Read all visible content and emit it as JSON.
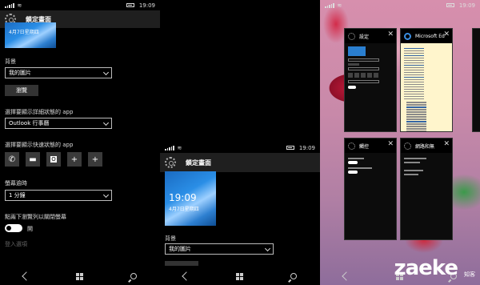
{
  "panel1": {
    "status_time": "19:09",
    "header_title": "鎖定畫面",
    "preview_date": "4月7日星期四",
    "background_label": "背景",
    "background_value": "我的圖片",
    "browse_button": "瀏覽",
    "detail_app_label": "選擇要顯示詳細狀態的 app",
    "detail_app_value": "Outlook 行事曆",
    "quick_app_label": "選擇要顯示快速狀態的 app",
    "quick_tiles": [
      "phone-icon",
      "message-icon",
      "outlook-icon",
      "add-icon",
      "add-icon"
    ],
    "timeout_label": "螢幕逾時",
    "timeout_value": "1 分鐘",
    "swipe_label": "點兩下瀏覽列以關閉螢幕",
    "toggle_state": "開",
    "signin_label": "登入選項"
  },
  "panel2": {
    "status_time": "19:09",
    "header_title": "鎖定畫面",
    "preview_time": "19:09",
    "preview_date": "4月7日星期四",
    "background_label": "背景",
    "background_value": "我的圖片"
  },
  "panel3": {
    "status_time": "19:09",
    "cards": [
      {
        "title": "設定",
        "icon": "gear-icon"
      },
      {
        "title": "Microsoft Ed",
        "icon": "edge-icon"
      },
      {
        "title": "觸控",
        "icon": "gear-icon"
      },
      {
        "title": "網路和無",
        "icon": "gear-icon"
      }
    ],
    "watermark": "zaeke",
    "watermark_sub": "知客"
  }
}
